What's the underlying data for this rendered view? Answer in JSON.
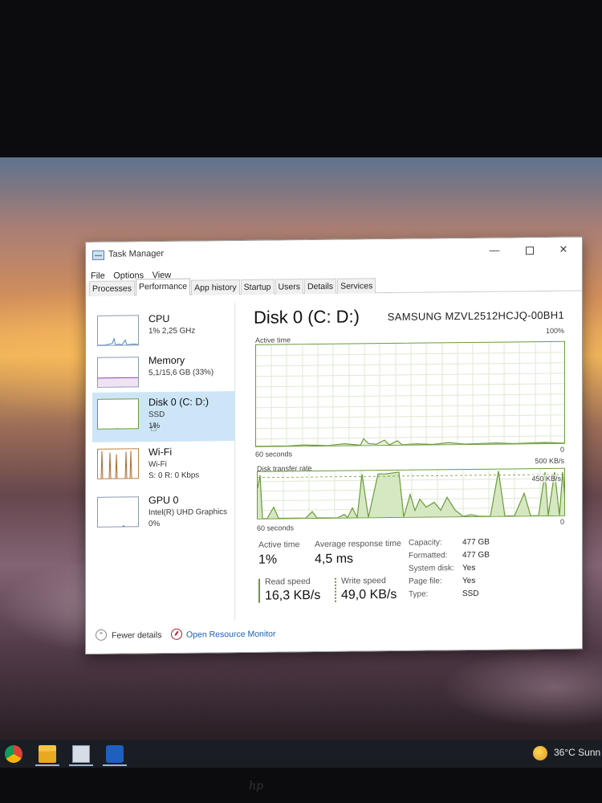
{
  "window": {
    "title": "Task Manager",
    "controls": {
      "minimize": "—",
      "maximize": "",
      "close": "✕"
    }
  },
  "menu": [
    "File",
    "Options",
    "View"
  ],
  "tabs": [
    "Processes",
    "Performance",
    "App history",
    "Startup",
    "Users",
    "Details",
    "Services"
  ],
  "active_tab": "Performance",
  "sidebar": {
    "cpu": {
      "name": "CPU",
      "detail": "1% 2,25 GHz"
    },
    "memory": {
      "name": "Memory",
      "detail": "5,1/15,6 GB (33%)"
    },
    "disk": {
      "name": "Disk 0 (C: D:)",
      "type": "SSD",
      "detail": "1%"
    },
    "wifi": {
      "name": "Wi-Fi",
      "sub": "Wi-Fi",
      "detail": "S: 0 R: 0 Kbps"
    },
    "gpu": {
      "name": "GPU 0",
      "sub": "Intel(R) UHD Graphics",
      "detail": "0%"
    }
  },
  "main": {
    "title": "Disk 0 (C: D:)",
    "model": "SAMSUNG MZVL2512HCJQ-00BH1",
    "active_graph": {
      "label": "Active time",
      "max": "100%",
      "min": "0",
      "time": "60 seconds"
    },
    "transfer_graph": {
      "label": "Disk transfer rate",
      "max": "500 KB/s",
      "mid": "450 KB/s",
      "min": "0",
      "time": "60 seconds"
    },
    "stats": {
      "active_time_label": "Active time",
      "active_time_value": "1%",
      "avg_response_label": "Average response time",
      "avg_response_value": "4,5 ms",
      "read_label": "Read speed",
      "read_value": "16,3 KB/s",
      "write_label": "Write speed",
      "write_value": "49,0 KB/s"
    },
    "properties": [
      {
        "key": "Capacity:",
        "value": "477 GB"
      },
      {
        "key": "Formatted:",
        "value": "477 GB"
      },
      {
        "key": "System disk:",
        "value": "Yes"
      },
      {
        "key": "Page file:",
        "value": "Yes"
      },
      {
        "key": "Type:",
        "value": "SSD"
      }
    ]
  },
  "footer": {
    "fewer_details": "Fewer details",
    "open_resource_monitor": "Open Resource Monitor"
  },
  "taskbar": {
    "weather": "36°C  Sunn"
  },
  "colors": {
    "accent_green": "#6a9b3a",
    "selected": "#cde6f7",
    "link": "#1a5fb4"
  }
}
